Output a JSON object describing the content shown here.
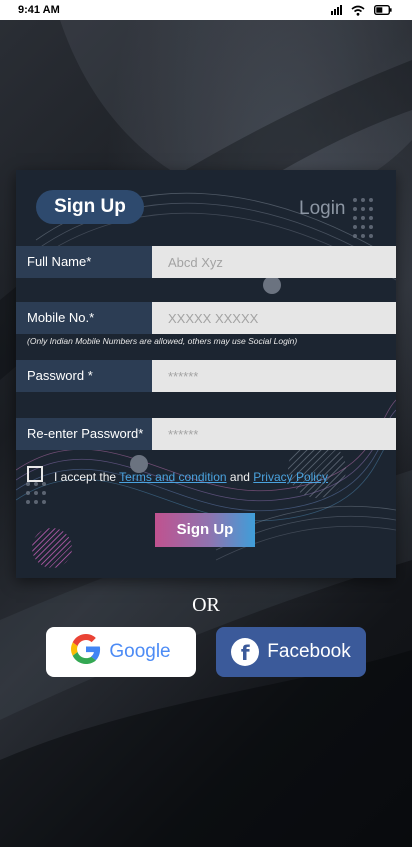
{
  "status_bar": {
    "time": "9:41 AM"
  },
  "tabs": {
    "signup_label": "Sign Up",
    "login_label": "Login"
  },
  "form": {
    "full_name": {
      "label": "Full Name*",
      "placeholder": "Abcd Xyz"
    },
    "mobile": {
      "label": "Mobile No.*",
      "placeholder": "XXXXX XXXXX",
      "hint": "(Only Indian Mobile Numbers are allowed, others may use Social Login)"
    },
    "password": {
      "label": "Password *",
      "placeholder": "******"
    },
    "reenter_password": {
      "label": "Re-enter Password*",
      "placeholder": "******"
    },
    "accept": {
      "prefix": "I accept the",
      "terms_link": "Terms and condition",
      "and_text": "and",
      "privacy_link": "Privacy Policy"
    },
    "submit_label": "Sign Up"
  },
  "or_text": "OR",
  "social": {
    "google_label": "Google",
    "facebook_label": "Facebook"
  },
  "colors": {
    "card_bg": "#1c2531",
    "label_bg": "#2c3d54",
    "link": "#4aa3df",
    "facebook": "#3b5a9a",
    "google_text": "#4c8bf5"
  }
}
